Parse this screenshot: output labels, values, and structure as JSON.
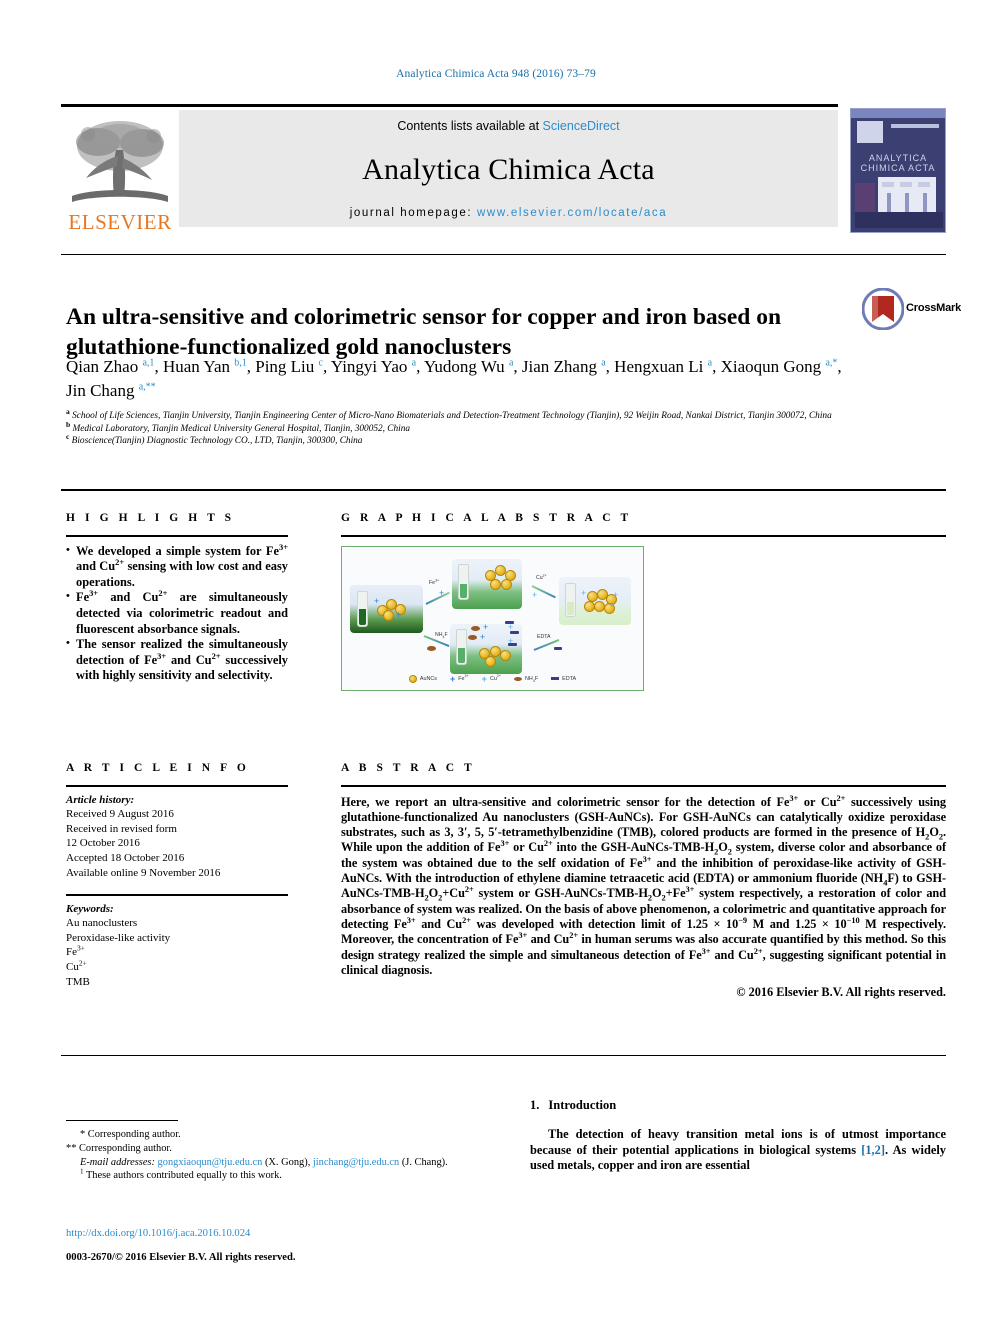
{
  "running_head": "Analytica Chimica Acta 948 (2016) 73–79",
  "masthead": {
    "contents_prefix": "Contents lists available at ",
    "sciencedirect": "ScienceDirect",
    "journal_title": "Analytica Chimica Acta",
    "homepage_label": "journal homepage: ",
    "homepage_url": "www.elsevier.com/locate/aca",
    "publisher": "ELSEVIER",
    "cover_title": "ANALYTICA CHIMICA ACTA"
  },
  "article": {
    "title": "An ultra-sensitive and colorimetric sensor for copper and iron based on glutathione-functionalized gold nanoclusters",
    "crossmark_label": "CrossMark",
    "authors_html": "Qian Zhao <sup>a,1</sup>, Huan Yan <sup>b,1</sup>, Ping Liu <sup>c</sup>, Yingyi Yao <sup>a</sup>, Yudong Wu <sup>a</sup>, Jian Zhang <sup>a</sup>, Hengxuan Li <sup>a</sup>, Xiaoqun Gong <sup>a,*</sup>, Jin Chang <sup>a,**</sup>",
    "affiliations": [
      "School of Life Sciences, Tianjin University, Tianjin Engineering Center of Micro-Nano Biomaterials and Detection-Treatment Technology (Tianjin), 92 Weijin Road, Nankai District, Tianjin 300072, China",
      "Medical Laboratory, Tianjin Medical University General Hospital, Tianjin, 300052, China",
      "Bioscience(Tianjin) Diagnostic Technology CO., LTD, Tianjin, 300300, China"
    ],
    "affiliation_marks": [
      "a",
      "b",
      "c"
    ]
  },
  "highlights": {
    "heading": "H I G H L I G H T S",
    "items_html": [
      "We developed a simple system for Fe<sup>3+</sup> and Cu<sup>2+</sup> sensing with low cost and easy operations.",
      "Fe<sup>3+</sup> and Cu<sup>2+</sup> are simultaneously detected via colorimetric readout and fluorescent absorbance signals.",
      "The sensor realized the simultaneously detection of Fe<sup>3+</sup> and Cu<sup>2+</sup> successively with highly sensitivity and selectivity."
    ]
  },
  "graphical_abstract": {
    "heading": "G R A P H I C A L  A B S T R A C T",
    "arrow_labels": [
      "Fe3+",
      "Cu2+",
      "NH4F",
      "EDTA"
    ],
    "legend": [
      {
        "icon": "gold-nanocluster-dot",
        "label": "AuNCs"
      },
      {
        "icon": "fe-plus-icon",
        "label": "Fe3+"
      },
      {
        "icon": "cu-plus-icon",
        "label": "Cu2+"
      },
      {
        "icon": "nh4f-ellipse-icon",
        "label": "NH4F"
      },
      {
        "icon": "edta-bar-icon",
        "label": "EDTA"
      }
    ]
  },
  "article_info": {
    "heading": "A R T I C L E  I N F O",
    "history_label": "Article history:",
    "history": [
      "Received 9 August 2016",
      "Received in revised form",
      "12 October 2016",
      "Accepted 18 October 2016",
      "Available online 9 November 2016"
    ],
    "keywords_label": "Keywords:",
    "keywords_html": [
      "Au nanoclusters",
      "Peroxidase-like activity",
      "Fe<sup>3+</sup>",
      "Cu<sup>2+</sup>",
      "TMB"
    ]
  },
  "abstract": {
    "heading": "A B S T R A C T",
    "body_html": "Here, we report an ultra-sensitive and colorimetric sensor for the detection of Fe<sup>3+</sup> or Cu<sup>2+</sup> successively using glutathione-functionalized Au nanoclusters (GSH-AuNCs). For GSH-AuNCs can catalytically oxidize peroxidase substrates, such as 3, 3&prime;, 5, 5&prime;-tetramethylbenzidine (TMB), colored products are formed in the presence of H<sub>2</sub>O<sub>2</sub>. While upon the addition of Fe<sup>3+</sup> or Cu<sup>2+</sup> into the GSH-AuNCs-TMB-H<sub>2</sub>O<sub>2</sub> system, diverse color and absorbance of the system was obtained due to the self oxidation of Fe<sup>3+</sup> and the inhibition of peroxidase-like activity of GSH-AuNCs. With the introduction of ethylene diamine tetraacetic acid (EDTA) or ammonium fluoride (NH<sub>4</sub>F) to GSH-AuNCs-TMB-H<sub>2</sub>O<sub>2</sub>+Cu<sup>2+</sup> system or GSH-AuNCs-TMB-H<sub>2</sub>O<sub>2</sub>+Fe<sup>3+</sup> system respectively, a restoration of color and absorbance of system was realized. On the basis of above phenomenon, a colorimetric and quantitative approach for detecting Fe<sup>3+</sup> and Cu<sup>2+</sup> was developed with detection limit of 1.25 &times; 10<sup>&minus;9</sup> M and 1.25 &times; 10<sup>&minus;10</sup> M respectively. Moreover, the concentration of Fe<sup>3+</sup> and Cu<sup>2+</sup> in human serums was also accurate quantified by this method. So this design strategy realized the simple and simultaneous detection of Fe<sup>3+</sup> and Cu<sup>2+</sup>, suggesting significant potential in clinical diagnosis.",
    "copyright": "© 2016 Elsevier B.V. All rights reserved."
  },
  "footnotes": {
    "corresponding_1": "* Corresponding author.",
    "corresponding_2": "** Corresponding author.",
    "email_label": "E-mail addresses:",
    "email_1": "gongxiaoqun@tju.edu.cn",
    "email_1_owner": "(X. Gong)",
    "email_2": "jinchang@tju.edu.cn",
    "email_2_owner": "(J. Chang).",
    "equal_contrib": "These authors contributed equally to this work.",
    "equal_contrib_mark": "1"
  },
  "doi_block": {
    "doi": "http://dx.doi.org/10.1016/j.aca.2016.10.024",
    "issn_line": "0003-2670/© 2016 Elsevier B.V. All rights reserved."
  },
  "introduction": {
    "number": "1.",
    "heading": "Introduction",
    "paragraph_prefix": "The detection of heavy transition metal ions is of utmost importance because of their potential applications in biological systems ",
    "citation": "[1,2]",
    "paragraph_suffix": ". As widely used metals, copper and iron are essential"
  },
  "colors": {
    "link": "#2b8ccc",
    "running_head": "#1a6fa8",
    "elsevier_orange": "#E87722",
    "ga_border": "#6ab06a",
    "masthead_bg": "#e9e9e9"
  }
}
